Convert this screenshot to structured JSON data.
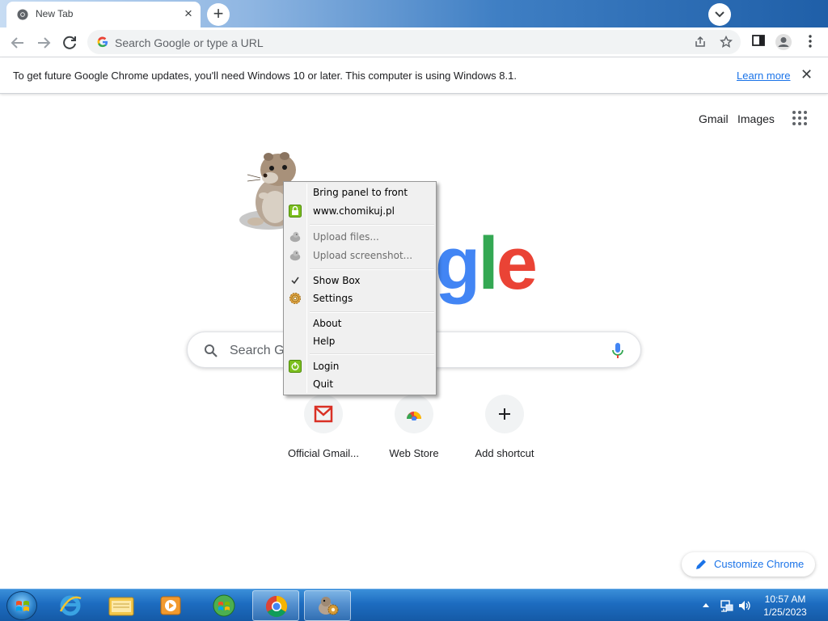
{
  "browser": {
    "tab": {
      "title": "New Tab",
      "close_glyph": "×"
    },
    "new_tab_glyph": "+",
    "omnibox": {
      "placeholder": "Search Google or type a URL"
    }
  },
  "infobar": {
    "message": "To get future Google Chrome updates, you'll need Windows 10 or later. This computer is using Windows 8.1.",
    "link": "Learn more",
    "close_glyph": "✕"
  },
  "ntp": {
    "top_links": [
      "Gmail",
      "Images"
    ],
    "logo_letters": [
      {
        "char": "g",
        "color": "#4285f4"
      },
      {
        "char": "l",
        "color": "#34a853"
      },
      {
        "char": "e",
        "color": "#ea4335"
      }
    ],
    "search_placeholder": "Search Go",
    "shortcuts": [
      {
        "label": "Official Gmail...",
        "icon": "gmail-icon"
      },
      {
        "label": "Web Store",
        "icon": "chrome-web-store-icon"
      },
      {
        "label": "Add shortcut",
        "icon": "plus-icon"
      }
    ],
    "customize_label": "Customize Chrome"
  },
  "context_menu": {
    "items": [
      {
        "label": "Bring panel to front",
        "icon": "",
        "enabled": true
      },
      {
        "label": "www.chomikuj.pl",
        "icon": "lock-icon",
        "enabled": true
      },
      {
        "label": "Upload files...",
        "icon": "hamster-icon",
        "enabled": false
      },
      {
        "label": "Upload screenshot...",
        "icon": "hamster-icon",
        "enabled": false
      },
      {
        "label": "Show Box",
        "icon": "checkmark-icon",
        "enabled": true
      },
      {
        "label": "Settings",
        "icon": "gear-icon",
        "enabled": true
      },
      {
        "label": "About",
        "icon": "",
        "enabled": true
      },
      {
        "label": "Help",
        "icon": "",
        "enabled": true
      },
      {
        "label": "Login",
        "icon": "power-icon",
        "enabled": true
      },
      {
        "label": "Quit",
        "icon": "",
        "enabled": true
      }
    ]
  },
  "taskbar": {
    "buttons": [
      "internet-explorer-icon",
      "file-explorer-icon",
      "media-player-icon",
      "control-panel-icon",
      "chrome-icon",
      "chomikbox-icon"
    ],
    "clock_time": "10:57 AM",
    "clock_date": "1/25/2023"
  },
  "colors": {
    "accent": "#1a73e8",
    "taskbar": "#1d6cc0"
  }
}
